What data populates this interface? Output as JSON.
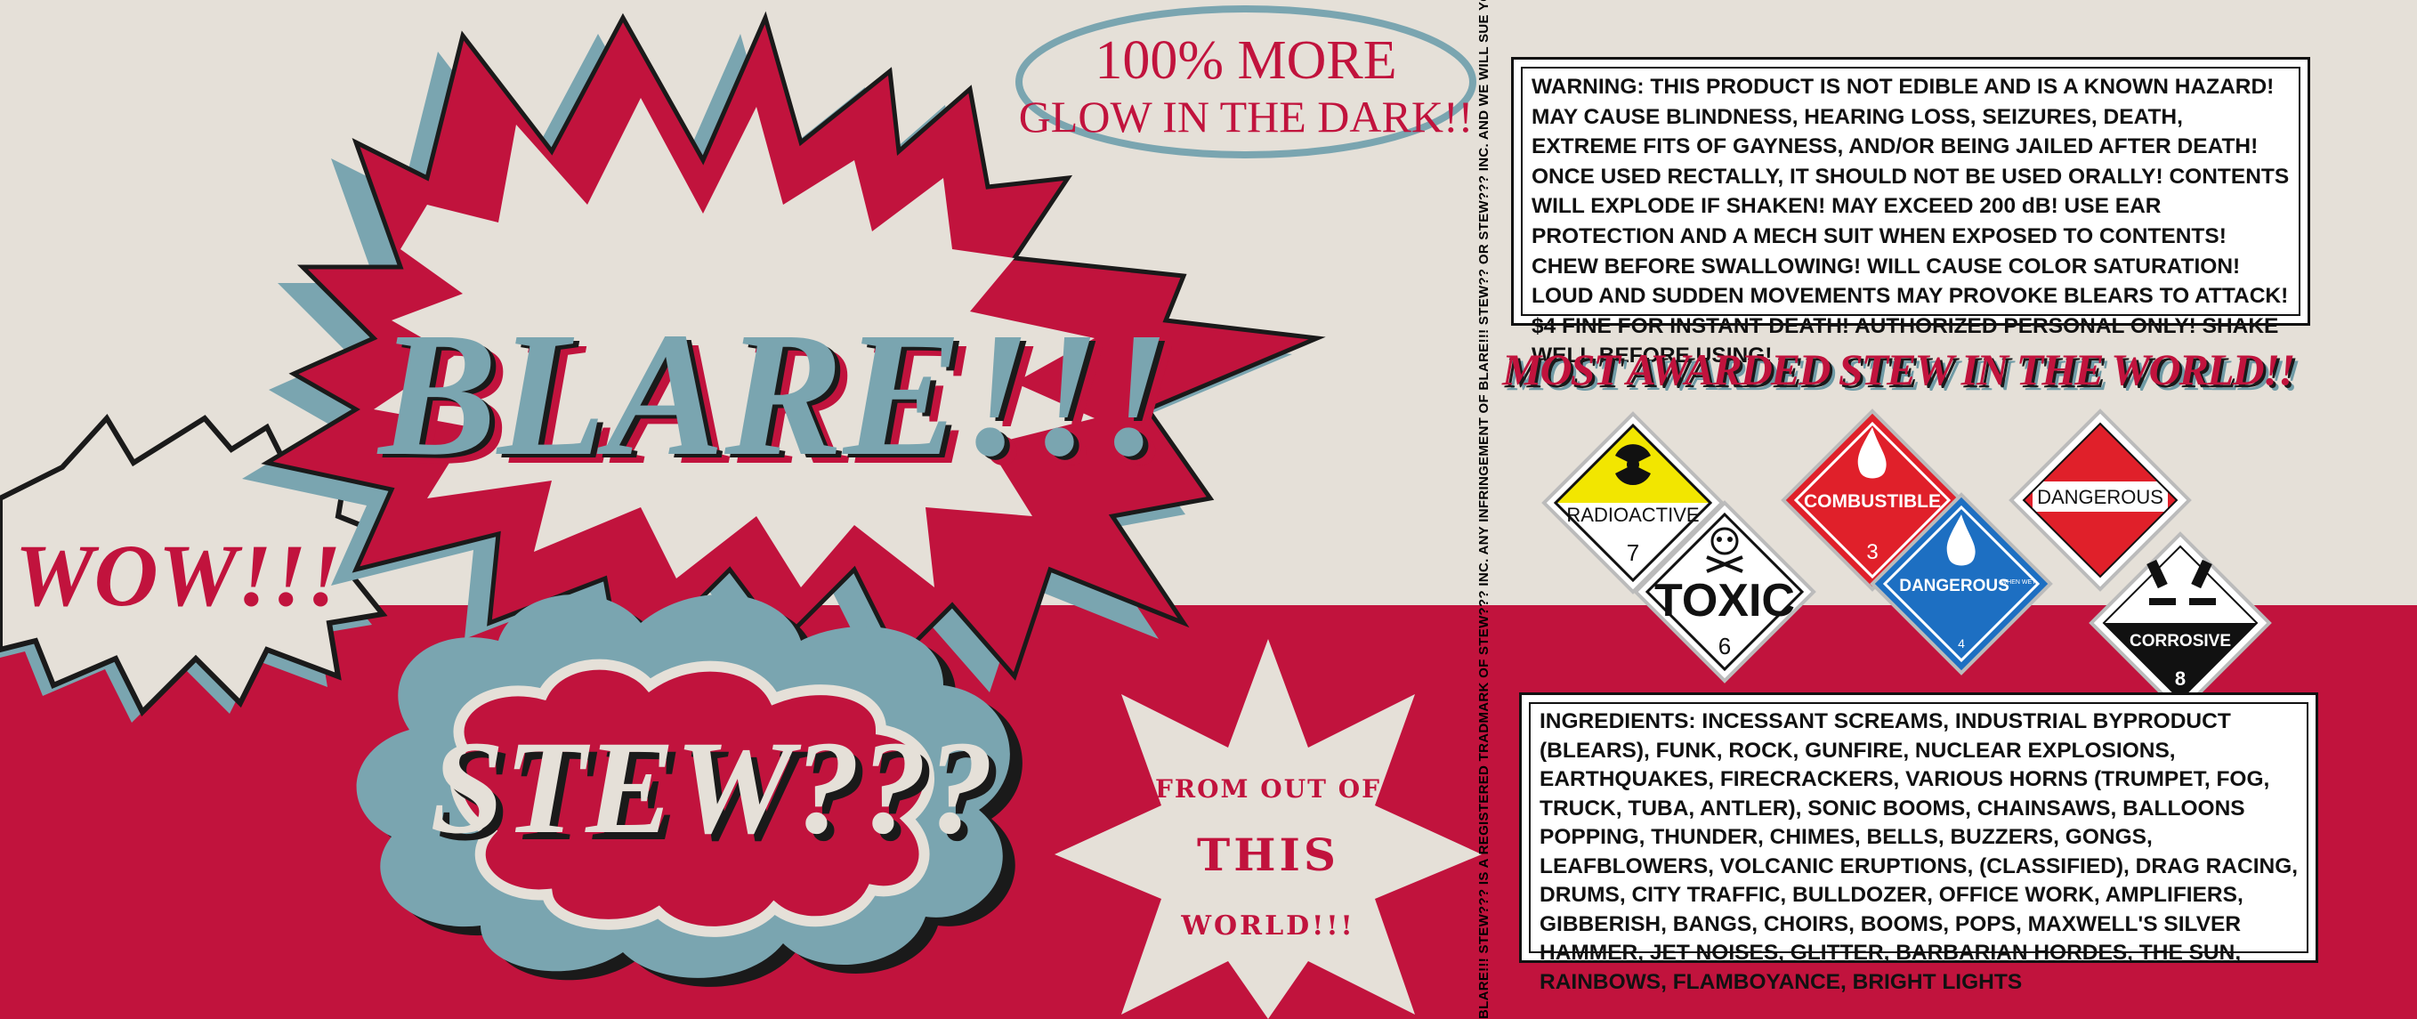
{
  "label": {
    "brand": "BLARE!!!",
    "product": "STEW???",
    "burst_left": "WOW!!!",
    "oval_line1": "100% MORE",
    "oval_line2": "GLOW IN THE DARK!!",
    "star_line1": "FROM OUT OF",
    "star_line2": "THIS",
    "star_line3": "WORLD!!!",
    "side_legal": "BLARE!!! STEW??? IS A REGISTERED TRADMARK OF STEW??? INC. ANY INFRINGEMENT OF BLARE!!! STEW?? OR STEW??? INC. AND WE WILL SUE YOU, BUDDY!!!",
    "award": "MOST AWARDED STEW IN THE WORLD!!",
    "warning": "WARNING: THIS PRODUCT IS NOT EDIBLE AND IS A KNOWN HAZARD! MAY CAUSE BLINDNESS, HEARING LOSS, SEIZURES, DEATH, EXTREME FITS OF GAYNESS, AND/OR BEING JAILED AFTER DEATH! ONCE USED RECTALLY, IT SHOULD NOT BE USED ORALLY! CONTENTS WILL EXPLODE IF SHAKEN! MAY EXCEED 200 dB! USE EAR PROTECTION AND A MECH SUIT WHEN EXPOSED TO CONTENTS! CHEW BEFORE SWALLOWING! WILL CAUSE COLOR SATURATION! LOUD AND SUDDEN MOVEMENTS MAY PROVOKE BLEARS TO ATTACK! $4 FINE FOR INSTANT DEATH! AUTHORIZED PERSONAL ONLY! SHAKE WELL BEFORE USING!",
    "ingredients": "INGREDIENTS: INCESSANT SCREAMS, INDUSTRIAL BYPRODUCT (BLEARS), FUNK, ROCK, GUNFIRE, NUCLEAR EXPLOSIONS, EARTHQUAKES, FIRECRACKERS, VARIOUS HORNS (TRUMPET, FOG, TRUCK, TUBA, ANTLER), SONIC BOOMS, CHAINSAWS, BALLOONS POPPING, THUNDER, CHIMES, BELLS, BUZZERS, GONGS, LEAFBLOWERS, VOLCANIC ERUPTIONS, (CLASSIFIED), DRAG RACING, DRUMS, CITY TRAFFIC, BULLDOZER, OFFICE WORK, AMPLIFIERS, GIBBERISH, BANGS, CHOIRS, BOOMS, POPS, MAXWELL'S SILVER HAMMER, JET NOISES, GLITTER, BARBARIAN HORDES, THE SUN, RAINBOWS, FLAMBOYANCE, BRIGHT LIGHTS"
  },
  "hazards": {
    "radioactive": {
      "label": "RADIOACTIVE",
      "number": "7"
    },
    "toxic": {
      "label": "TOXIC",
      "number": "6"
    },
    "combustible": {
      "label": "COMBUSTIBLE",
      "number": "3"
    },
    "dangerous_wet": {
      "label": "DANGEROUS",
      "sublabel": "WHEN WET",
      "number": "4"
    },
    "dangerous": {
      "label": "DANGEROUS"
    },
    "corrosive": {
      "label": "CORROSIVE",
      "number": "8"
    }
  },
  "colors": {
    "red": "#c1133d",
    "blue": "#7aa5b0",
    "cream": "#e5e0d8",
    "ink": "#1a1a1a",
    "hazard_yellow": "#f2e600",
    "hazard_red": "#e0202a",
    "hazard_blue": "#1d6fc2"
  }
}
